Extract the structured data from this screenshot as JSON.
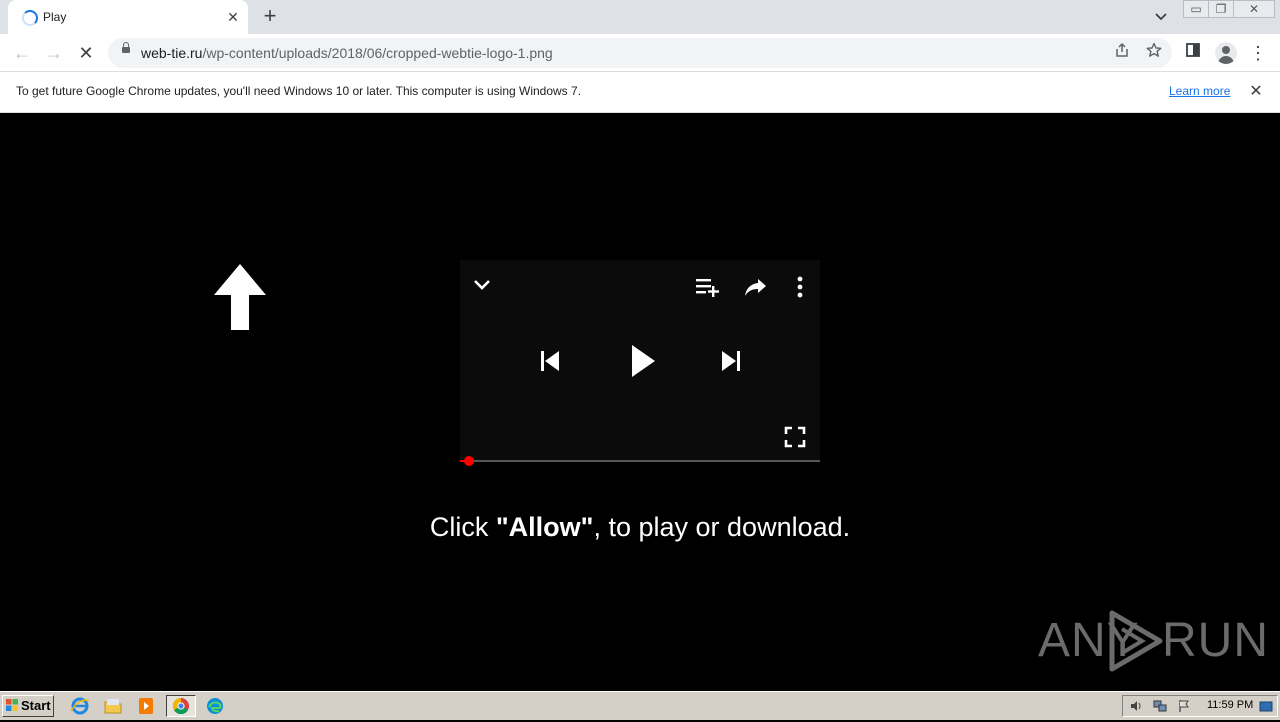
{
  "browser": {
    "tab": {
      "title": "Play",
      "close_glyph": "✕"
    },
    "new_tab_glyph": "+",
    "tab_search_glyph": "⌄",
    "window_controls": {
      "minimize": "▭",
      "restore": "❐",
      "close": "✕"
    },
    "nav": {
      "back": "←",
      "forward": "→",
      "reload": "✕"
    },
    "url": {
      "host": "web-tie.ru",
      "path": "/wp-content/uploads/2018/06/cropped-webtie-logo-1.png"
    },
    "menu_glyph": "⋮"
  },
  "infobar": {
    "message": "To get future Google Chrome updates, you'll need Windows 10 or later. This computer is using Windows 7.",
    "link": "Learn more",
    "close_glyph": "✕"
  },
  "page": {
    "caption_pre": "Click ",
    "caption_bold": "\"Allow\"",
    "caption_post": ", to play or download.",
    "player": {
      "progress_fraction": 0.01
    },
    "watermark": {
      "left": "ANY",
      "right": "RUN"
    }
  },
  "taskbar": {
    "start_label": "Start",
    "clock": "11:59 PM"
  },
  "colors": {
    "accent": "#1a73e8",
    "progress": "#ff0000",
    "page_bg": "#000000"
  }
}
